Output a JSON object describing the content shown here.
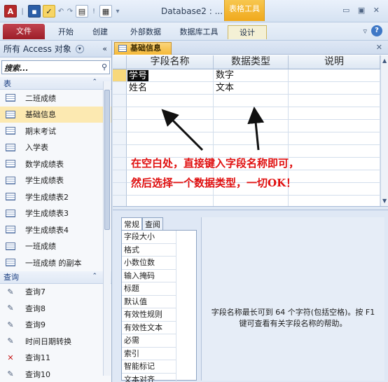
{
  "titlebar": {
    "title": "Database2 : ...",
    "context_tab": "表格工具",
    "window_controls": "▭ ▣ ✕"
  },
  "ribbon": {
    "tabs": [
      "文件",
      "开始",
      "创建",
      "外部数据",
      "数据库工具",
      "设计"
    ],
    "help_glyph": "?",
    "minimize_glyph": "▿"
  },
  "nav": {
    "header": "所有 Access 对象",
    "collapse_glyph": "«",
    "search_placeholder": "搜索...",
    "tables_group": "表",
    "tables": [
      "二班成绩",
      "基础信息",
      "期末考试",
      "入学表",
      "数学成绩表",
      "学生成绩表",
      "学生成绩表2",
      "学生成绩表3",
      "学生成绩表4",
      "一班成绩",
      "一班成绩 的副本"
    ],
    "selected_table": "基础信息",
    "queries_group": "查询",
    "queries": [
      "查询7",
      "查询8",
      "查询9",
      "时间日期转换",
      "查询11",
      "查询10"
    ]
  },
  "document": {
    "tab_title": "基础信息",
    "close_glyph": "✕",
    "columns": [
      "字段名称",
      "数据类型",
      "说明"
    ],
    "rows": [
      {
        "field": "学号",
        "type": "数字",
        "desc": ""
      },
      {
        "field": "姓名",
        "type": "文本",
        "desc": ""
      }
    ],
    "annotation_line1": "在空白处，直接键入字段名称即可，",
    "annotation_line2": "然后选择一个数据类型，一切OK！"
  },
  "properties": {
    "tabs": [
      "常规",
      "查阅"
    ],
    "items": [
      "字段大小",
      "格式",
      "小数位数",
      "输入掩码",
      "标题",
      "默认值",
      "有效性规则",
      "有效性文本",
      "必需",
      "索引",
      "智能标记",
      "文本对齐"
    ],
    "help_text": "字段名称最长可到 64 个字符(包括空格)。按 F1 键可查看有关字段名称的帮助。"
  }
}
